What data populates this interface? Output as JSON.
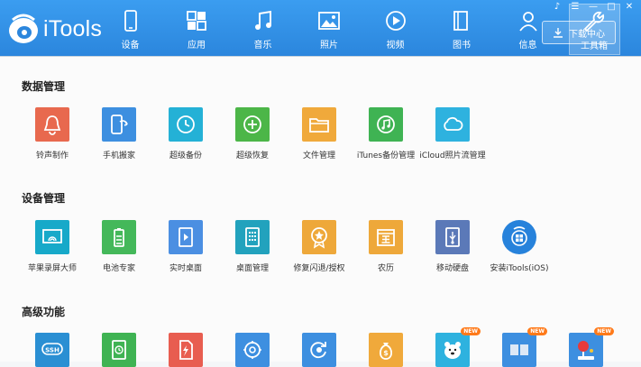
{
  "app": {
    "name": "iTools"
  },
  "nav": [
    {
      "label": "设备",
      "icon": "phone-icon"
    },
    {
      "label": "应用",
      "icon": "apps-grid-icon"
    },
    {
      "label": "音乐",
      "icon": "music-note-icon"
    },
    {
      "label": "照片",
      "icon": "photo-icon"
    },
    {
      "label": "视频",
      "icon": "play-circle-icon"
    },
    {
      "label": "图书",
      "icon": "book-icon"
    },
    {
      "label": "信息",
      "icon": "user-icon"
    },
    {
      "label": "工具箱",
      "icon": "wrench-icon",
      "active": true
    }
  ],
  "download_button": {
    "label": "下载中心"
  },
  "sections": {
    "data": {
      "title": "数据管理",
      "items": [
        {
          "label": "铃声制作",
          "color": "#e8694e",
          "icon": "bell-icon"
        },
        {
          "label": "手机搬家",
          "color": "#3d8fe0",
          "icon": "phone-transfer-icon"
        },
        {
          "label": "超级备份",
          "color": "#24b1d6",
          "icon": "clock-backup-icon"
        },
        {
          "label": "超级恢复",
          "color": "#4cb648",
          "icon": "restore-plus-icon"
        },
        {
          "label": "文件管理",
          "color": "#f0a93b",
          "icon": "folder-icon"
        },
        {
          "label": "iTunes备份管理",
          "color": "#3fb353",
          "icon": "itunes-icon"
        },
        {
          "label": "iCloud照片流管理",
          "color": "#2eb2df",
          "icon": "cloud-icon"
        }
      ]
    },
    "device": {
      "title": "设备管理",
      "items": [
        {
          "label": "苹果录屏大师",
          "color": "#17a9c9",
          "icon": "screen-cast-icon"
        },
        {
          "label": "电池专家",
          "color": "#44b85a",
          "icon": "battery-icon"
        },
        {
          "label": "实时桌面",
          "color": "#4b8fe2",
          "icon": "live-desktop-icon"
        },
        {
          "label": "桌面管理",
          "color": "#22a2bd",
          "icon": "desktop-grid-icon"
        },
        {
          "label": "修复闪退/授权",
          "color": "#eea83a",
          "icon": "star-badge-icon"
        },
        {
          "label": "农历",
          "color": "#eea83a",
          "icon": "calendar-icon"
        },
        {
          "label": "移动硬盘",
          "color": "#5b79b8",
          "icon": "usb-drive-icon"
        },
        {
          "label": "安装iTools(iOS)",
          "color": "#2782db",
          "icon": "itools-install-icon"
        }
      ]
    },
    "advanced": {
      "title": "高级功能",
      "items": [
        {
          "label": "SSH",
          "color": "#2a8fd3",
          "icon": "ssh-icon"
        },
        {
          "label": "",
          "color": "#3fb353",
          "icon": "document-clock-icon"
        },
        {
          "label": "",
          "color": "#e85d50",
          "icon": "flash-file-icon"
        },
        {
          "label": "",
          "color": "#3d8fe0",
          "icon": "settings-icon"
        },
        {
          "label": "",
          "color": "#3d8fe0",
          "icon": "refresh-gear-icon"
        },
        {
          "label": "",
          "color": "#f0a93b",
          "icon": "money-bag-icon"
        },
        {
          "label": "",
          "color": "#2eb2df",
          "icon": "bear-icon",
          "badge": "NEW"
        },
        {
          "label": "",
          "color": "#3d8fe0",
          "icon": "window-tiles-icon",
          "badge": "NEW"
        },
        {
          "label": "",
          "color": "#3d8fe0",
          "icon": "joystick-icon",
          "badge": "NEW"
        }
      ]
    }
  }
}
